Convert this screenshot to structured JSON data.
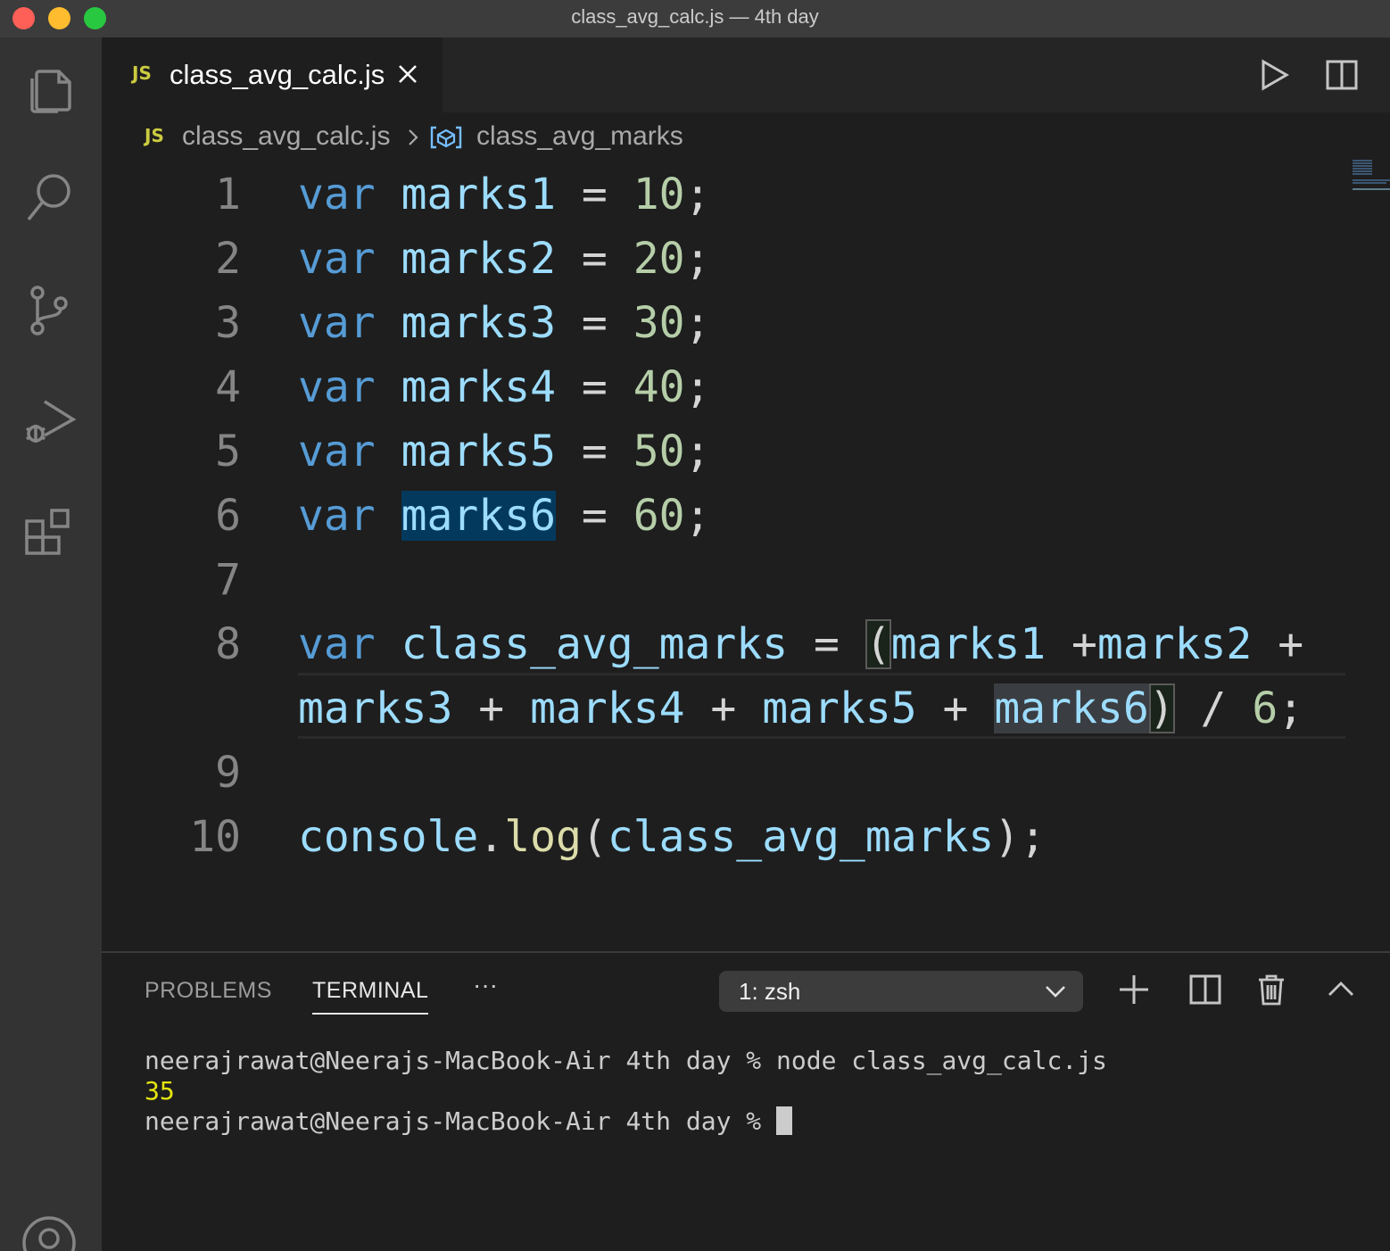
{
  "window": {
    "title": "class_avg_calc.js — 4th day"
  },
  "activity_bar": {
    "items": [
      "explorer-icon",
      "search-icon",
      "source-control-icon",
      "run-debug-icon",
      "extensions-icon",
      "account-icon"
    ]
  },
  "tabs": [
    {
      "badge": "JS",
      "label": "class_avg_calc.js",
      "active": true
    }
  ],
  "editor_actions": [
    "run-icon",
    "split-editor-icon"
  ],
  "breadcrumb": {
    "badge": "JS",
    "file": "class_avg_calc.js",
    "symbol": "class_avg_marks"
  },
  "editor": {
    "line_numbers": [
      "1",
      "2",
      "3",
      "4",
      "5",
      "6",
      "7",
      "8",
      "9",
      "10"
    ],
    "lines": [
      "var marks1 = 10;",
      "var marks2 = 20;",
      "var marks3 = 30;",
      "var marks4 = 40;",
      "var marks5 = 50;",
      "var marks6 = 60;",
      "",
      "var class_avg_marks = (marks1 +marks2 + marks3 + marks4 + marks5 + marks6) / 6;",
      "",
      "console.log(class_avg_marks);"
    ],
    "tokens": {
      "var": "var",
      "eq": "=",
      "semi": ";",
      "m1": "marks1",
      "m2": "marks2",
      "m3": "marks3",
      "m4": "marks4",
      "m5": "marks5",
      "m6": "marks6",
      "n10": "10",
      "n20": "20",
      "n30": "30",
      "n40": "40",
      "n50": "50",
      "n60": "60",
      "avg": "class_avg_marks",
      "lparen": "(",
      "rparen": ")",
      "plus": "+",
      "div": "/",
      "n6": "6",
      "console": "console",
      "dot": ".",
      "log": "log"
    }
  },
  "panel": {
    "tabs": [
      {
        "label": "PROBLEMS",
        "active": false
      },
      {
        "label": "TERMINAL",
        "active": true
      }
    ],
    "more": "···",
    "terminal_select": "1: zsh",
    "actions": [
      "plus-icon",
      "split-terminal-icon",
      "trash-icon",
      "chevron-up-icon"
    ],
    "terminal": {
      "line1_prompt": "neerajrawat@Neerajs-MacBook-Air 4th day % ",
      "line1_cmd": "node class_avg_calc.js",
      "line2_output": "35",
      "line3_prompt": "neerajrawat@Neerajs-MacBook-Air 4th day % "
    }
  },
  "colors": {
    "keyword": "#569cd6",
    "variable": "#9cdcfe",
    "number": "#b5cea8",
    "function": "#dcdcaa",
    "js_badge": "#cbcb41",
    "terminal_output": "#e5e510"
  }
}
